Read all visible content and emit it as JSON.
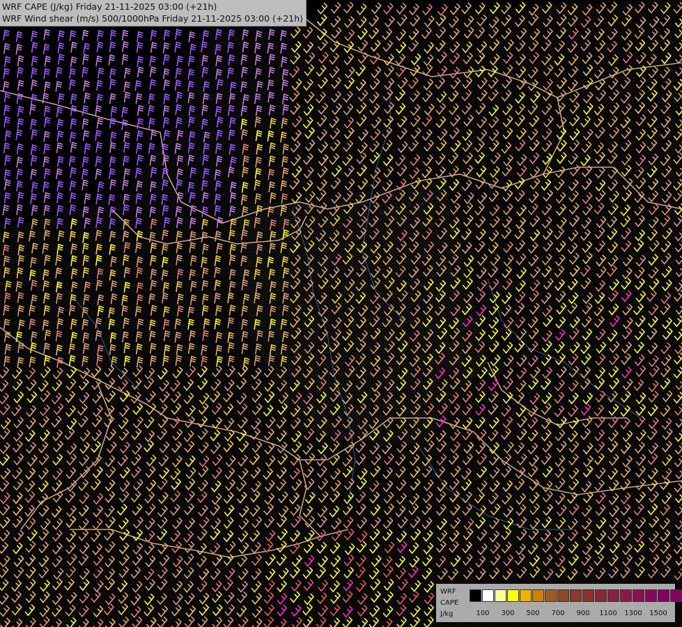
{
  "title": {
    "line1": "WRF CAPE (J/kg) Friday 21-11-2025 03:00 (+21h)",
    "line2": "WRF Wind shear (m/s) 500/1000hPa Friday 21-11-2025 03:00 (+21h)"
  },
  "legend": {
    "label_line1": "WRF",
    "label_line2": "CAPE",
    "label_line3": "J/kg",
    "swatches": [
      "#000000",
      "#ffffff",
      "#ffff99",
      "#ffff00",
      "#f0b400",
      "#d08000",
      "#a05a20",
      "#8b4a22",
      "#8b3a2a",
      "#8b3030",
      "#8b2838",
      "#8b2040",
      "#8b1848",
      "#8b1050",
      "#8b0858",
      "#880060",
      "#880068"
    ],
    "ticks": [
      "100",
      "300",
      "500",
      "700",
      "900",
      "1100",
      "1300",
      "1500"
    ]
  },
  "map": {
    "barb_colors": [
      "#9b5cff",
      "#c080e0",
      "#d8a070",
      "#e0b060",
      "#f0d040",
      "#ffff20",
      "#e08070",
      "#e06060",
      "#ff30c0"
    ],
    "border_color": "#e8c0a0",
    "river_color": "#3a78c8"
  }
}
